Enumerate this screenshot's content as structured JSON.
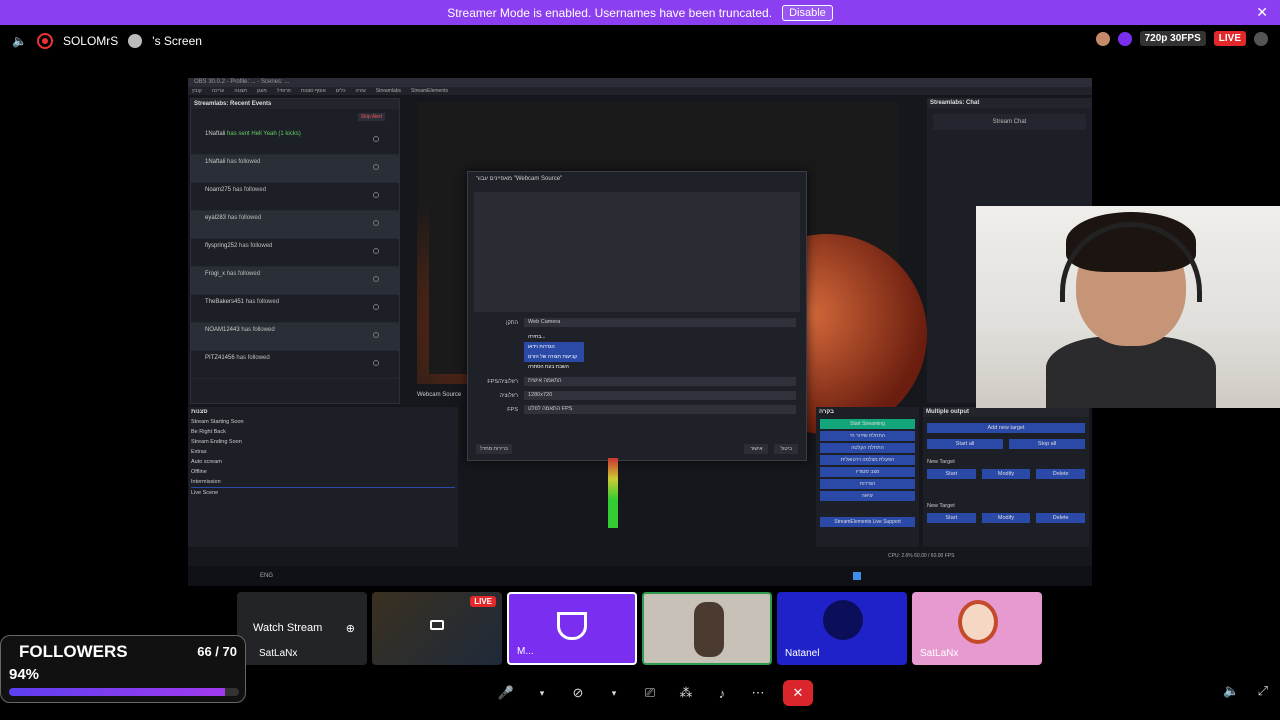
{
  "banner": {
    "text": "Streamer Mode is enabled. Usernames have been truncated.",
    "disable_label": "Disable",
    "close": "✕"
  },
  "topbar": {
    "user": "SOLOMrS",
    "screen": "'s Screen",
    "quality": "720p 30FPS",
    "live": "LIVE"
  },
  "obs": {
    "title": "OBS 30.0.2 - Profile: ... - Scenes: ...",
    "menu": [
      "קובץ",
      "עריכה",
      "תצוגה",
      "מעגן",
      "פרופיל",
      "אוסף סצנות",
      "כלים",
      "עזרה",
      "Streamlabs",
      "StreamElements"
    ],
    "events_title": "Streamlabs: Recent Events",
    "skip_alert": "Skip Alert",
    "events": [
      {
        "name": "1Naftali",
        "text": "has sent Hell Yeah (1 kicks)"
      },
      {
        "name": "1Naftali",
        "text": "has followed"
      },
      {
        "name": "Noam275",
        "text": "has followed"
      },
      {
        "name": "eyal283",
        "text": "has followed"
      },
      {
        "name": "flyspring252",
        "text": "has followed"
      },
      {
        "name": "Frogi_x",
        "text": "has followed"
      },
      {
        "name": "TheBakers451",
        "text": "has followed"
      },
      {
        "name": "NOAM12443",
        "text": "has followed"
      },
      {
        "name": "PITZ41456",
        "text": "has followed"
      }
    ],
    "dialog_title": "מאפיינים עבור \"Webcam Source\"",
    "device_label": "התקן",
    "device_value": "Web Camera",
    "menu_items": [
      "בחירה...",
      "הגדרות וידאו",
      "קביעות תצורה של הזרם",
      "השבת בעת הסתרה"
    ],
    "fps_label": "FPS/רזולוציה",
    "fps_value": "התאמה אישית",
    "res_label": "רזולוציה",
    "res_value": "1280x720",
    "fps2_label": "FPS",
    "fps2_value": "התאמה לפלט FPS",
    "defaults_btn": "ברירות מחדל",
    "ok_btn": "אישור",
    "cancel_btn": "ביטול",
    "chat_title": "Streamlabs: Chat",
    "chat_btn": "Stream Chat",
    "scenes_title": "סצנות",
    "scenes": [
      "Stream Starting Soon",
      "Be Right Back",
      "Stream Ending Soon",
      "Extras",
      "Auto scream",
      "Offline",
      "Intermission",
      "Live Scene"
    ],
    "controls_title": "בקרה",
    "controls": [
      "Start Streaming",
      "התחלת שידור חי",
      "התחלת הקלטה",
      "הפעלת מצלמה וירטואלית",
      "מצב סטודיו",
      "הגדרות",
      "יציאה"
    ],
    "se_support": "StreamElements Live Support",
    "multi_title": "Multiple output",
    "add_target": "Add new target",
    "start_all": "Start all",
    "stop_all": "Stop all",
    "new_target": "New Target",
    "start": "Start",
    "modify": "Modify",
    "delete": "Delete",
    "status": "CPU: 2.6% 60.00 / 60.00 FPS",
    "lang": "ENG",
    "webcam_source": "Webcam Source"
  },
  "tiles": [
    {
      "name": "SatLaNx",
      "label": "Watch Stream"
    },
    {
      "name": "",
      "live": "LIVE"
    },
    {
      "name": "M..."
    },
    {
      "name": ""
    },
    {
      "name": "Natanel"
    },
    {
      "name": "SatLaNx"
    }
  ],
  "followers": {
    "title": "FOLLOWERS",
    "count": "66 / 70",
    "pct": "94%",
    "progress": 0.94
  },
  "colors": {
    "accent": "#8b3ff0",
    "live": "#e3282b"
  }
}
